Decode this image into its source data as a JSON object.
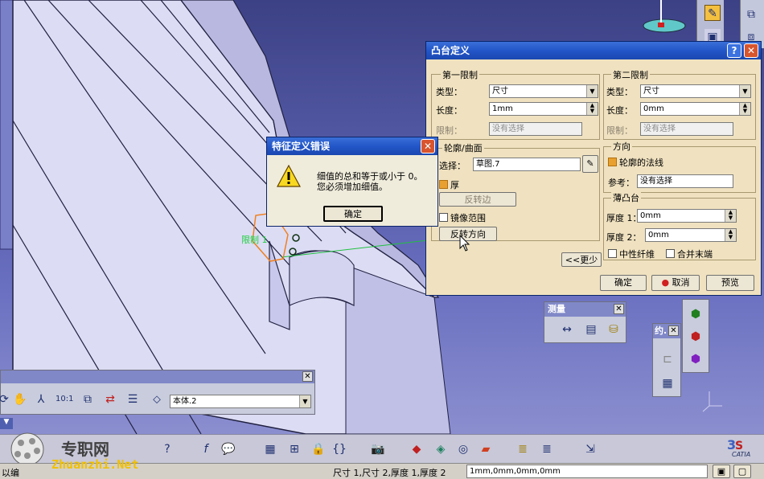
{
  "boss_dialog": {
    "title": "凸台定义",
    "help_glyph": "?",
    "close_glyph": "✕",
    "first_limit": {
      "title": "第一限制",
      "type_label": "类型：",
      "type_value": "尺寸",
      "length_label": "长度：",
      "length_value": "1mm",
      "limit_label": "限制：",
      "limit_value": "没有选择"
    },
    "second_limit": {
      "title": "第二限制",
      "type_label": "类型：",
      "type_value": "尺寸",
      "length_label": "长度：",
      "length_value": "0mm",
      "limit_label": "限制：",
      "limit_value": "没有选择"
    },
    "profile": {
      "title": "轮廓/曲面",
      "select_label": "选择：",
      "select_value": "草图.7",
      "thick_label": "厚",
      "reverse_side_button": "反转边",
      "mirror_label": "镜像范围",
      "reverse_direction_button": "反转方向"
    },
    "direction": {
      "title": "方向",
      "normal_label": "轮廓的法线",
      "reference_label": "参考：",
      "reference_value": "没有选择"
    },
    "thin_boss": {
      "title": "薄凸台",
      "thickness1_label": "厚度 1：",
      "thickness1_value": "0mm",
      "thickness2_label": "厚度 2：",
      "thickness2_value": "0mm",
      "neutral_fiber_label": "中性纤维",
      "merge_ends_label": "合并末端"
    },
    "less_button": "<<更少",
    "ok_button": "确定",
    "cancel_button": "取消",
    "preview_button": "预览"
  },
  "error_dialog": {
    "title": "特征定义错误",
    "close_glyph": "✕",
    "message_line1": "细值的总和等于或小于 0。",
    "message_line2": "您必须增加细值。",
    "ok_button": "确定"
  },
  "viewport": {
    "limit_label": "限制 1"
  },
  "measure_toolbar": {
    "title": "测量",
    "close_glyph": "✕"
  },
  "constraint_toolbar": {
    "title": "约.",
    "close_glyph": "✕"
  },
  "body_toolbar": {
    "close_glyph": "✕",
    "body_select_value": "本体.2"
  },
  "bottom_toolbar": {
    "watermark_brand": "专职网",
    "watermark_url": "Zhuanzhi.Net",
    "catia_logo": "CATIA"
  },
  "status_bar": {
    "left_text": "以编",
    "hint_text": "尺寸 1,尺寸 2,厚度 1,厚度 2",
    "value_field": "1mm,0mm,0mm,0mm"
  },
  "colors": {
    "title_blue": "#2356c8",
    "dialog_bg": "#f0e2c0",
    "viewport_bg": "#565ca8",
    "part_face": "#d8d8f0"
  }
}
